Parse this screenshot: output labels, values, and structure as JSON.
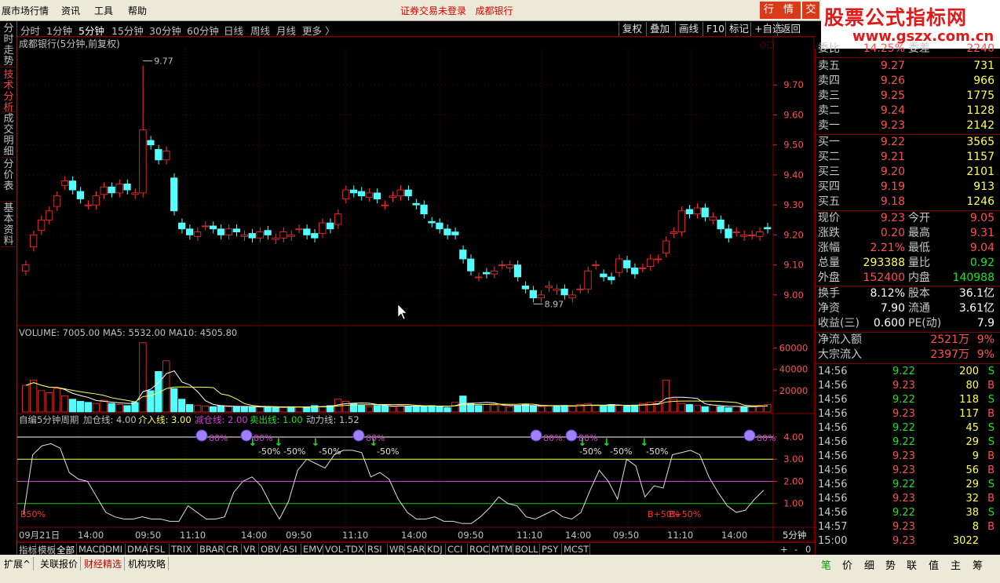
{
  "menu": {
    "items": [
      "展市场行情",
      "资讯",
      "工具",
      "帮助"
    ],
    "warning": "证券交易未登录",
    "stock": "成都银行",
    "quote_btn": "行 情",
    "quote_btn2": "交"
  },
  "logo": {
    "line1": "股票公式指标网",
    "line2": "www.gszx.com.cn"
  },
  "left_tabs": [
    {
      "label": "分时走势",
      "active": false
    },
    {
      "label": "技术分析",
      "active": true
    },
    {
      "label": "成交明细",
      "active": false
    },
    {
      "label": "分价表",
      "active": false
    },
    {
      "label": "基本资料",
      "active": false
    }
  ],
  "periods": [
    "分时",
    "1分钟",
    "5分钟",
    "15分钟",
    "30分钟",
    "60分钟",
    "日线",
    "周线",
    "月线",
    "更多 〉"
  ],
  "active_period": "5分钟",
  "toolbar_right": [
    "复权",
    "叠加",
    "画线",
    "F10",
    "标记",
    "+自选",
    "返回"
  ],
  "main_chart": {
    "title": "成都银行(5分钟,前复权)",
    "high_label": "9.77",
    "low_label": "8.97",
    "y_labels": [
      "9.70",
      "9.60",
      "9.50",
      "9.40",
      "9.30",
      "9.20",
      "9.10",
      "9.00"
    ]
  },
  "volume_chart": {
    "header_label": "VOLUME: 7005.00",
    "ma5_label": "MA5: 5532.00",
    "ma10_label": "MA10: 4505.80",
    "y_labels": [
      "60000",
      "40000",
      "20000"
    ]
  },
  "indicator": {
    "name": "自编5分钟周期",
    "jiacang": "加仓线: 4.00",
    "jieru": "介入线: 3.00",
    "jiancang": "减仓线: 2.00",
    "maichu": "卖出线: 1.00",
    "dongli": "动力线: 1.52",
    "y_labels": [
      "4.00",
      "3.00",
      "2.00",
      "1.00"
    ],
    "left_label": "B50%",
    "right_label": "B+50%",
    "right_label2": "B+50%",
    "pct80": "80%",
    "pct_minus50": "-50%"
  },
  "x_axis": {
    "labels": [
      "09月21日",
      "14:00",
      "09:50",
      "11:10",
      "14:00",
      "09:50",
      "11:10",
      "14:00",
      "09:50",
      "11:10",
      "14:00"
    ],
    "period_label": "5分钟"
  },
  "bottom_tabs": [
    "指标",
    "模板",
    "全部",
    "MACD",
    "DMI",
    "DMA",
    "FSL",
    "TRIX",
    "BRAR",
    "CR",
    "VR",
    "OBV",
    "ASI",
    "EMV",
    "VOL-TDX",
    "RSI",
    "WR",
    "SAR",
    "KDJ",
    "CCI",
    "ROC",
    "MTM",
    "BOLL",
    "PSY",
    "MCST"
  ],
  "bottom_right": [
    "+",
    "-",
    "0"
  ],
  "status_tabs": [
    "扩展^",
    "关联报价",
    "财经精选",
    "机构攻略"
  ],
  "right_panel": {
    "header": {
      "label_a": "委比",
      "value_a": "14.25%",
      "label_b": "委差",
      "value_b": "2240"
    },
    "asks": [
      {
        "label": "卖五",
        "price": "9.27",
        "vol": "731"
      },
      {
        "label": "卖四",
        "price": "9.26",
        "vol": "966"
      },
      {
        "label": "卖三",
        "price": "9.25",
        "vol": "1775"
      },
      {
        "label": "卖二",
        "price": "9.24",
        "vol": "1128"
      },
      {
        "label": "卖一",
        "price": "9.23",
        "vol": "2142"
      }
    ],
    "bids": [
      {
        "label": "买一",
        "price": "9.22",
        "vol": "3565"
      },
      {
        "label": "买二",
        "price": "9.21",
        "vol": "1157"
      },
      {
        "label": "买三",
        "price": "9.20",
        "vol": "2101"
      },
      {
        "label": "买四",
        "price": "9.19",
        "vol": "913"
      },
      {
        "label": "买五",
        "price": "9.18",
        "vol": "1246"
      }
    ],
    "stats": [
      {
        "a": "现价",
        "b": "9.23",
        "bc": "red",
        "c": "今开",
        "d": "9.05",
        "dc": "red"
      },
      {
        "a": "涨跌",
        "b": "0.20",
        "bc": "red",
        "c": "最高",
        "d": "9.31",
        "dc": "red"
      },
      {
        "a": "涨幅",
        "b": "2.21%",
        "bc": "red",
        "c": "最低",
        "d": "9.04",
        "dc": "red"
      },
      {
        "a": "总量",
        "b": "293388",
        "bc": "yel",
        "c": "量比",
        "d": "0.92",
        "dc": "grn"
      },
      {
        "a": "外盘",
        "b": "152400",
        "bc": "red",
        "c": "内盘",
        "d": "140988",
        "dc": "grn"
      }
    ],
    "stats2": [
      {
        "a": "换手",
        "b": "8.12%",
        "bc": "wht",
        "c": "股本",
        "d": "36.1亿",
        "dc": "wht"
      },
      {
        "a": "净资",
        "b": "7.90",
        "bc": "wht",
        "c": "流通",
        "d": "3.61亿",
        "dc": "wht"
      },
      {
        "a": "收益(三)",
        "b": "0.600",
        "bc": "wht",
        "c": "PE(动)",
        "d": "7.9",
        "dc": "wht"
      }
    ],
    "flows": [
      {
        "label": "净流入额",
        "value": "2521万",
        "pct": "9%"
      },
      {
        "label": "大宗流入",
        "value": "2397万",
        "pct": "9%"
      }
    ],
    "ticks": [
      {
        "t": "14:56",
        "p": "9.22",
        "pc": "grn",
        "v": "200",
        "s": "S",
        "sc": "grn"
      },
      {
        "t": "14:56",
        "p": "9.23",
        "pc": "red",
        "v": "80",
        "s": "B",
        "sc": "red"
      },
      {
        "t": "14:56",
        "p": "9.22",
        "pc": "grn",
        "v": "118",
        "s": "S",
        "sc": "grn"
      },
      {
        "t": "14:56",
        "p": "9.23",
        "pc": "red",
        "v": "117",
        "s": "B",
        "sc": "red"
      },
      {
        "t": "14:56",
        "p": "9.22",
        "pc": "grn",
        "v": "45",
        "s": "S",
        "sc": "grn"
      },
      {
        "t": "14:56",
        "p": "9.22",
        "pc": "grn",
        "v": "29",
        "s": "S",
        "sc": "grn"
      },
      {
        "t": "14:56",
        "p": "9.23",
        "pc": "red",
        "v": "9",
        "s": "B",
        "sc": "red"
      },
      {
        "t": "14:56",
        "p": "9.23",
        "pc": "red",
        "v": "56",
        "s": "B",
        "sc": "red"
      },
      {
        "t": "14:56",
        "p": "9.22",
        "pc": "grn",
        "v": "29",
        "s": "S",
        "sc": "grn"
      },
      {
        "t": "14:56",
        "p": "9.23",
        "pc": "red",
        "v": "32",
        "s": "B",
        "sc": "red"
      },
      {
        "t": "14:56",
        "p": "9.22",
        "pc": "grn",
        "v": "38",
        "s": "S",
        "sc": "grn"
      },
      {
        "t": "14:57",
        "p": "9.23",
        "pc": "red",
        "v": "8",
        "s": "B",
        "sc": "red"
      },
      {
        "t": "15:00",
        "p": "9.23",
        "pc": "red",
        "v": "3022",
        "s": "",
        "sc": "mag",
        "vc": "mag"
      }
    ],
    "tabs": [
      "笔",
      "价",
      "细",
      "势",
      "联",
      "值",
      "主",
      "筹"
    ]
  },
  "chart_data": {
    "type": "candlestick",
    "price_range": [
      8.95,
      9.8
    ],
    "closes": [
      9.1,
      9.2,
      9.25,
      9.28,
      9.33,
      9.38,
      9.35,
      9.32,
      9.3,
      9.33,
      9.36,
      9.34,
      9.37,
      9.35,
      9.34,
      9.55,
      9.5,
      9.45,
      9.48,
      9.28,
      9.22,
      9.2,
      9.21,
      9.23,
      9.22,
      9.2,
      9.22,
      9.21,
      9.2,
      9.19,
      9.21,
      9.2,
      9.19,
      9.21,
      9.2,
      9.22,
      9.2,
      9.19,
      9.24,
      9.22,
      9.27,
      9.35,
      9.34,
      9.33,
      9.34,
      9.32,
      9.3,
      9.33,
      9.35,
      9.33,
      9.3,
      9.27,
      9.24,
      9.22,
      9.2,
      9.2,
      9.12,
      9.08,
      9.06,
      9.07,
      9.08,
      9.1,
      9.1,
      9.06,
      9.02,
      8.99,
      9.0,
      9.03,
      9.02,
      9.0,
      9.0,
      9.02,
      9.08,
      9.1,
      9.06,
      9.05,
      9.12,
      9.09,
      9.07,
      9.09,
      9.12,
      9.12,
      9.18,
      9.21,
      9.28,
      9.27,
      9.29,
      9.26,
      9.26,
      9.22,
      9.19,
      9.21,
      9.2,
      9.2,
      9.21,
      9.22
    ],
    "volume_range": [
      0,
      70000
    ],
    "volumes": [
      25000,
      30000,
      20000,
      18000,
      22000,
      15000,
      12000,
      10000,
      9000,
      8000,
      11000,
      8000,
      7000,
      6000,
      9000,
      65000,
      20000,
      38000,
      48000,
      22000,
      12000,
      7000,
      6000,
      5500,
      5000,
      6000,
      5000,
      4800,
      5000,
      4500,
      4600,
      5000,
      4000,
      4200,
      5000,
      4600,
      4800,
      6000,
      5000,
      6000,
      12000,
      10000,
      8000,
      6000,
      5000,
      6000,
      5800,
      5000,
      6000,
      5500,
      5000,
      5800,
      6000,
      5000,
      4000,
      9000,
      15000,
      8000,
      6000,
      7000,
      6500,
      6000,
      5000,
      6000,
      7000,
      6000,
      5000,
      5500,
      6000,
      6200,
      5200,
      7000,
      8000,
      6000,
      5500,
      7000,
      6000,
      5500,
      6500,
      8000,
      9000,
      10000,
      30000,
      12000,
      8000,
      7000,
      6000,
      5000,
      6500,
      5000,
      4000,
      5200,
      4800,
      6000,
      6200,
      7005
    ],
    "indicator_range": [
      0,
      4.6
    ],
    "indicator": [
      0.5,
      3.2,
      3.6,
      3.7,
      3.5,
      2.4,
      2.1,
      2.0,
      1.3,
      0.6,
      0.4,
      0.3,
      0.3,
      0.4,
      0.3,
      0.3,
      0.2,
      0.2,
      0.9,
      0.6,
      0.3,
      0.3,
      0.4,
      1.5,
      2.0,
      2.2,
      1.8,
      1.0,
      0.3,
      1.1,
      2.5,
      3.0,
      2.8,
      2.6,
      3.2,
      3.4,
      3.4,
      3.3,
      2.2,
      2.4,
      2.1,
      1.2,
      0.6,
      0.3,
      0.3,
      0.4,
      0.2,
      0.2,
      0.1,
      0.1,
      0.4,
      0.8,
      1.3,
      1.0,
      0.9,
      0.4,
      0.3,
      0.5,
      0.7,
      0.4,
      0.3,
      0.6,
      1.6,
      2.5,
      2.0,
      1.2,
      3.0,
      2.7,
      1.3,
      1.8,
      1.7,
      3.2,
      3.3,
      3.4,
      3.2,
      2.2,
      1.5,
      0.9,
      0.6,
      0.7,
      1.2,
      1.6
    ]
  }
}
